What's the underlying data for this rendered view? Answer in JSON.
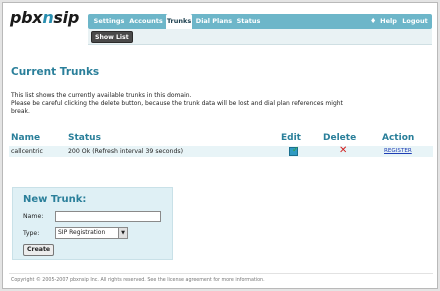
{
  "logo": {
    "prefix": "pbx",
    "swoosh": "n",
    "suffix": "sip"
  },
  "nav": {
    "tabs": [
      "Settings",
      "Accounts",
      "Trunks",
      "Dial Plans",
      "Status"
    ],
    "active_tab": "Trunks",
    "help": "Help",
    "logout": "Logout",
    "nav_icon": "diamond-arrow-icon"
  },
  "subnav": {
    "show_list": "Show List"
  },
  "page": {
    "title": "Current Trunks",
    "desc_line1": "This list shows the currently available trunks in this domain.",
    "desc_line2": "Please be careful clicking the delete button, because the trunk data will be lost and dial plan references might",
    "desc_line3": "break."
  },
  "table": {
    "headers": {
      "name": "Name",
      "status": "Status",
      "edit": "Edit",
      "delete": "Delete",
      "action": "Action"
    },
    "rows": [
      {
        "name": "callcentric",
        "status": "200 Ok (Refresh interval 39 seconds)",
        "action": "REGISTER"
      }
    ]
  },
  "new_trunk": {
    "title": "New Trunk:",
    "name_label": "Name:",
    "name_value": "",
    "type_label": "Type:",
    "type_value": "SIP Registration",
    "create": "Create"
  },
  "footer": "Copyright © 2005-2007 pbxnsip Inc. All rights reserved. See the license agreement for more information.",
  "colors": {
    "accent": "#2a7f9a",
    "nav": "#6db6c9",
    "row": "#e8f4f7",
    "panel": "#dff0f5",
    "link": "#1f3fb5",
    "delete": "#d21e1e"
  }
}
